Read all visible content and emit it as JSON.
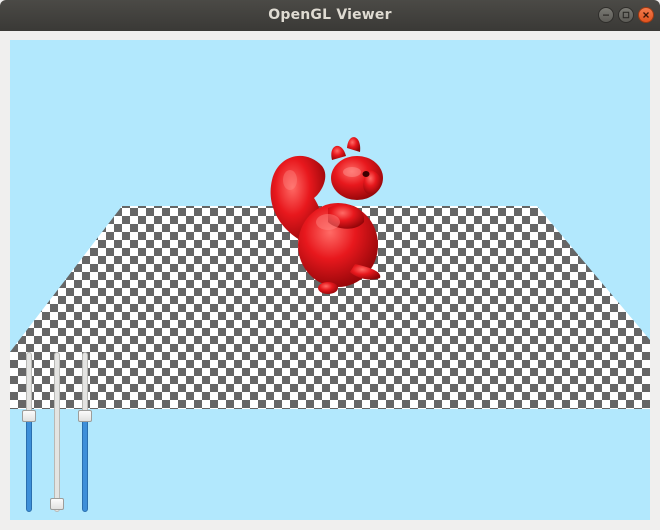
{
  "window": {
    "title": "OpenGL Viewer",
    "controls": [
      "minimize-icon",
      "maximize-icon",
      "close-icon"
    ],
    "close_color": "#e95420"
  },
  "viewport": {
    "background_color": "#b2e8fd",
    "floor": "checkerboard",
    "floor_colors": [
      "#555555",
      "#ffffff"
    ],
    "model": "squirrel",
    "model_color": "#e8171c"
  },
  "sliders": [
    {
      "name": "slider-1",
      "value": 0.62
    },
    {
      "name": "slider-2",
      "value": 0.0
    },
    {
      "name": "slider-3",
      "value": 0.62
    }
  ]
}
